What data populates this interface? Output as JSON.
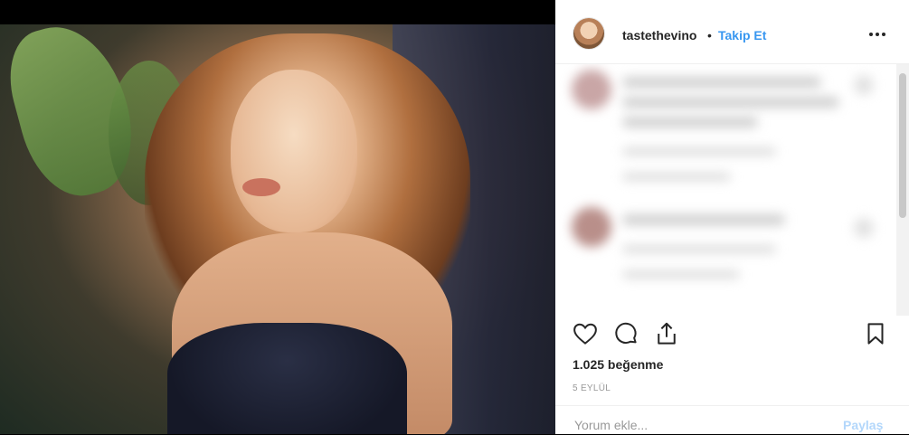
{
  "post": {
    "username": "tastethevino",
    "separator": "•",
    "follow_label": "Takip Et",
    "more_icon": "more-options-icon"
  },
  "actions": {
    "like_icon": "heart-icon",
    "comment_icon": "comment-icon",
    "share_icon": "share-icon",
    "save_icon": "bookmark-icon"
  },
  "likes_text": "1.025 beğenme",
  "date_text": "5 EYLÜL",
  "comment_box": {
    "placeholder": "Yorum ekle...",
    "post_label": "Paylaş"
  },
  "colors": {
    "accent": "#3897f0",
    "text": "#262626",
    "muted": "#999999"
  }
}
